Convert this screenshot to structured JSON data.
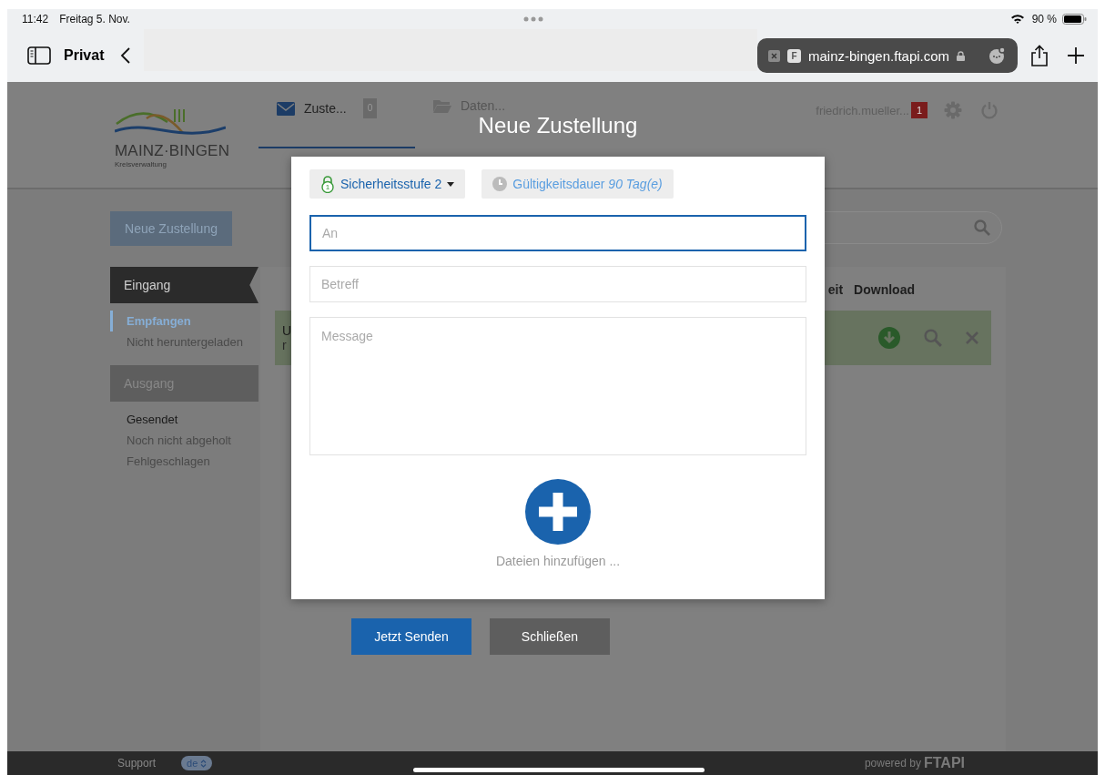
{
  "status_bar": {
    "time": "11:42",
    "date": "Freitag 5. Nov.",
    "battery": "90 %"
  },
  "browser": {
    "profile": "Privat",
    "favicon_letter": "F",
    "url": "mainz-bingen.ftapi.com"
  },
  "header": {
    "logo": {
      "name": "MAINZ·BINGEN",
      "subtitle": "Kreisverwaltung"
    },
    "tabs": [
      {
        "label": "Zuste...",
        "count": "0",
        "selected": true
      },
      {
        "label": "Daten...",
        "selected": false
      }
    ],
    "user": {
      "name": "friedrich.mueller...",
      "notifications": "1"
    }
  },
  "sidebar": {
    "new_button": "Neue Zustellung",
    "sections": [
      {
        "title": "Eingang",
        "selected": true,
        "items": [
          {
            "label": "Empfangen",
            "selected": true,
            "highlighted": false
          },
          {
            "label": "Nicht heruntergeladen",
            "selected": false,
            "highlighted": false
          }
        ]
      },
      {
        "title": "Ausgang",
        "selected": false,
        "items": [
          {
            "label": "Gesendet",
            "selected": false,
            "highlighted": true
          },
          {
            "label": "Noch nicht abgeholt",
            "selected": false,
            "highlighted": false
          },
          {
            "label": "Fehlgeschlagen",
            "selected": false,
            "highlighted": false
          }
        ]
      }
    ]
  },
  "table": {
    "columns": [
      "eit",
      "Download"
    ],
    "rows": [
      {
        "lines": [
          "U",
          "r"
        ],
        "color": "#67735f"
      }
    ]
  },
  "modal": {
    "title": "Neue Zustellung",
    "security": {
      "label": "Sicherheitsstufe 2",
      "lock_number": "1"
    },
    "validity": "Gültigkeitsdauer *90 Tag(e)*",
    "fields": [
      {
        "placeholder": "An",
        "kind": "input",
        "focused": true
      },
      {
        "placeholder": "Betreff",
        "kind": "input",
        "focused": false
      },
      {
        "placeholder": "Message",
        "kind": "textarea",
        "focused": false
      }
    ],
    "add_files": "Dateien hinzufügen ...",
    "buttons": [
      {
        "label": "Jetzt Senden",
        "kind": "primary"
      },
      {
        "label": "Schließen",
        "kind": "secondary"
      }
    ]
  },
  "footer": {
    "support": "Support",
    "language": "de",
    "powered": "powered by",
    "brand": "FTAPI"
  }
}
